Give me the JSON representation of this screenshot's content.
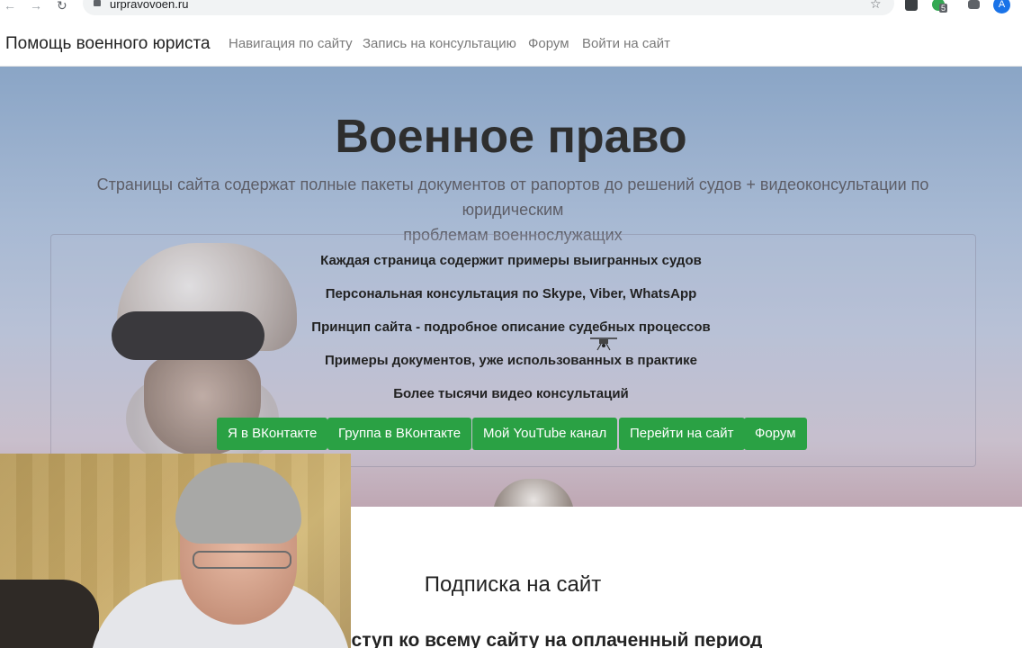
{
  "browser": {
    "url": "urpravovoen.ru",
    "back_icon": "arrow-left-icon",
    "forward_icon": "arrow-right-icon",
    "reload_icon": "reload-icon",
    "star_icon": "star-icon",
    "profile_initial": "A",
    "extension_badge": "5"
  },
  "navbar": {
    "brand": "Помощь военного юриста",
    "links": [
      "Навигация по сайту",
      "Запись на консультацию",
      "Форум",
      "Войти на сайт"
    ]
  },
  "hero": {
    "title": "Военное право",
    "subtitle_line1": "Страницы сайта содержат полные пакеты документов от рапортов до решений судов + видеоконсультации по юридическим",
    "subtitle_line2": "проблемам военнослужащих",
    "features": [
      "Каждая страница содержит примеры выигранных судов",
      "Персональная консультация по Skype, Viber, WhatsApp",
      "Принцип сайта - подробное описание судебных процессов",
      "Примеры документов, уже использованных в практике",
      "Более тысячи видео консультаций"
    ],
    "buttons": [
      "Я в ВКонтакте",
      "Группа в ВКонтакте",
      "Мой YouTube канал",
      "Перейти на сайт",
      "Форум"
    ],
    "button_color": "#2aa144"
  },
  "subscription": {
    "title": "Подписка на сайт",
    "subtitle": "оступ ко всему сайту на оплаченный период"
  }
}
